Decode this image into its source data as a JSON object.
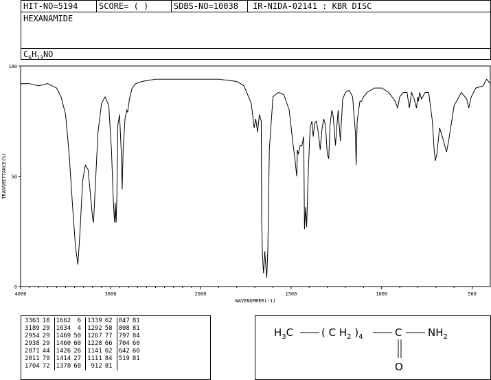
{
  "header": {
    "hit_no": "HIT-NO=5194",
    "score": "SCORE=  (   )",
    "sdbs_no": "SDBS-NO=10038",
    "ir_info": "IR-NIDA-02141 : KBR DISC",
    "compound_name": "HEXANAMIDE",
    "formula_parts": [
      "C",
      "6",
      "H",
      "13",
      "NO"
    ]
  },
  "chart_data": {
    "type": "line",
    "xlabel": "WAVENUMBER(-1)",
    "ylabel": "TRANSMITTANCE(%)",
    "xlim": [
      4000,
      400
    ],
    "ylim": [
      0,
      100
    ],
    "x_ticks": [
      "4000",
      "3000",
      "2000",
      "1500",
      "1000",
      "500"
    ],
    "x_tick_values": [
      4000,
      3000,
      2000,
      1500,
      1000,
      500
    ],
    "y_ticks": [
      "0",
      "50",
      "100"
    ],
    "y_tick_values": [
      0,
      50,
      100
    ],
    "x": [
      4000,
      3900,
      3800,
      3700,
      3600,
      3550,
      3500,
      3460,
      3420,
      3390,
      3363,
      3340,
      3310,
      3280,
      3250,
      3220,
      3200,
      3189,
      3170,
      3140,
      3100,
      3060,
      3020,
      2990,
      2970,
      2960,
      2954,
      2948,
      2938,
      2930,
      2920,
      2900,
      2880,
      2871,
      2860,
      2840,
      2820,
      2811,
      2790,
      2760,
      2720,
      2650,
      2500,
      2300,
      2100,
      2000,
      1900,
      1800,
      1760,
      1720,
      1704,
      1695,
      1685,
      1675,
      1665,
      1662,
      1658,
      1652,
      1645,
      1640,
      1634,
      1628,
      1620,
      1600,
      1570,
      1540,
      1510,
      1490,
      1480,
      1469,
      1465,
      1460,
      1450,
      1440,
      1430,
      1426,
      1420,
      1414,
      1405,
      1395,
      1385,
      1378,
      1370,
      1360,
      1350,
      1339,
      1330,
      1320,
      1310,
      1300,
      1292,
      1285,
      1275,
      1267,
      1255,
      1240,
      1228,
      1215,
      1200,
      1180,
      1160,
      1145,
      1141,
      1135,
      1120,
      1111,
      1100,
      1080,
      1060,
      1040,
      1000,
      960,
      925,
      912,
      900,
      880,
      860,
      847,
      835,
      820,
      808,
      800,
      797,
      790,
      780,
      760,
      740,
      720,
      710,
      704,
      695,
      680,
      665,
      655,
      642,
      630,
      600,
      560,
      530,
      519,
      505,
      480,
      440,
      420,
      400
    ],
    "y": [
      92,
      92,
      91,
      92,
      90,
      86,
      78,
      60,
      35,
      18,
      10,
      25,
      48,
      55,
      53,
      40,
      31,
      29,
      45,
      70,
      83,
      86,
      82,
      62,
      40,
      32,
      29,
      38,
      29,
      40,
      73,
      78,
      60,
      44,
      62,
      76,
      80,
      79,
      85,
      90,
      92,
      93,
      94,
      94,
      94,
      94,
      94,
      93,
      91,
      83,
      72,
      76,
      70,
      78,
      75,
      30,
      14,
      6,
      16,
      10,
      4,
      18,
      62,
      86,
      88,
      87,
      80,
      65,
      59,
      50,
      62,
      60,
      64,
      64,
      68,
      26,
      36,
      27,
      52,
      72,
      75,
      68,
      74,
      75,
      70,
      62,
      71,
      76,
      73,
      60,
      58,
      73,
      80,
      77,
      64,
      80,
      66,
      85,
      88,
      89,
      86,
      70,
      55,
      75,
      84,
      84,
      86,
      88,
      89,
      90,
      90,
      88,
      84,
      81,
      86,
      88,
      88,
      81,
      88,
      85,
      81,
      86,
      84,
      88,
      85,
      88,
      88,
      75,
      62,
      57,
      60,
      72,
      68,
      65,
      61,
      66,
      82,
      88,
      85,
      81,
      86,
      90,
      91,
      94,
      92
    ],
    "peak_table": [
      [
        3363,
        10
      ],
      [
        3189,
        29
      ],
      [
        2954,
        29
      ],
      [
        2938,
        29
      ],
      [
        2871,
        44
      ],
      [
        2811,
        79
      ],
      [
        1704,
        72
      ],
      [
        1662,
        6
      ],
      [
        1634,
        4
      ],
      [
        1469,
        50
      ],
      [
        1460,
        60
      ],
      [
        1426,
        26
      ],
      [
        1414,
        27
      ],
      [
        1378,
        68
      ],
      [
        1339,
        62
      ],
      [
        1292,
        58
      ],
      [
        1267,
        77
      ],
      [
        1228,
        66
      ],
      [
        1141,
        62
      ],
      [
        1111,
        84
      ],
      [
        912,
        81
      ],
      [
        847,
        81
      ],
      [
        808,
        81
      ],
      [
        797,
        84
      ],
      [
        704,
        60
      ],
      [
        642,
        60
      ],
      [
        519,
        81
      ]
    ]
  },
  "structure": {
    "left_group": "H3C",
    "chain": "(CH2)4",
    "carbon": "C",
    "amine": "NH2",
    "oxygen": "O"
  }
}
